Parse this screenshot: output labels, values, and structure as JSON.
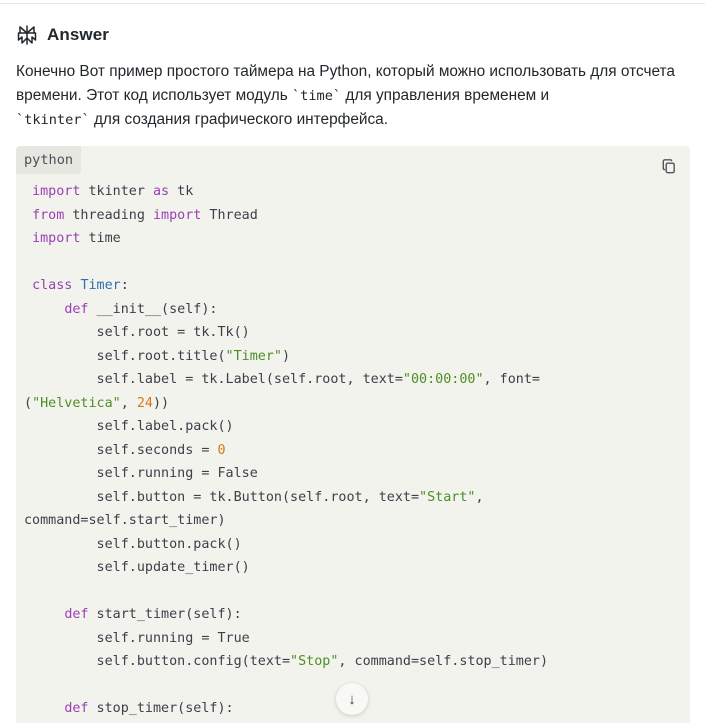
{
  "answer": {
    "title": "Answer",
    "icon": "perplexity-logo-icon"
  },
  "intro": {
    "text_1": "Конечно Вот пример простого таймера на Python, который можно использовать для отсчета времени. Этот код использует модуль ",
    "code_1": "`time`",
    "text_2": " для управления временем и ",
    "code_2": "`tkinter`",
    "text_3": " для создания графического интерфейса."
  },
  "code_block": {
    "language": "python",
    "copy_icon": "copy-icon",
    "lines": [
      [
        {
          "t": " "
        },
        {
          "t": "import",
          "c": "kw"
        },
        {
          "t": " tkinter "
        },
        {
          "t": "as",
          "c": "kw"
        },
        {
          "t": " tk"
        }
      ],
      [
        {
          "t": " "
        },
        {
          "t": "from",
          "c": "kw"
        },
        {
          "t": " threading "
        },
        {
          "t": "import",
          "c": "kw"
        },
        {
          "t": " Thread"
        }
      ],
      [
        {
          "t": " "
        },
        {
          "t": "import",
          "c": "kw"
        },
        {
          "t": " time"
        }
      ],
      [],
      [
        {
          "t": " "
        },
        {
          "t": "class",
          "c": "kw"
        },
        {
          "t": " "
        },
        {
          "t": "Timer",
          "c": "cls"
        },
        {
          "t": ":"
        }
      ],
      [
        {
          "t": "     "
        },
        {
          "t": "def",
          "c": "kw"
        },
        {
          "t": " __init__(self):"
        }
      ],
      [
        {
          "t": "         self.root = tk.Tk()"
        }
      ],
      [
        {
          "t": "         self.root.title("
        },
        {
          "t": "\"Timer\"",
          "c": "str"
        },
        {
          "t": ")"
        }
      ],
      [
        {
          "t": "         self.label = tk.Label(self.root, text="
        },
        {
          "t": "\"00:00:00\"",
          "c": "str"
        },
        {
          "t": ", font="
        }
      ],
      [
        {
          "t": "("
        },
        {
          "t": "\"Helvetica\"",
          "c": "str"
        },
        {
          "t": ", "
        },
        {
          "t": "24",
          "c": "num"
        },
        {
          "t": "))"
        }
      ],
      [
        {
          "t": "         self.label.pack()"
        }
      ],
      [
        {
          "t": "         self.seconds = "
        },
        {
          "t": "0",
          "c": "num"
        }
      ],
      [
        {
          "t": "         self.running = False"
        }
      ],
      [
        {
          "t": "         self.button = tk.Button(self.root, text="
        },
        {
          "t": "\"Start\"",
          "c": "str"
        },
        {
          "t": ","
        }
      ],
      [
        {
          "t": "command=self.start_timer)"
        }
      ],
      [
        {
          "t": "         self.button.pack()"
        }
      ],
      [
        {
          "t": "         self.update_timer()"
        }
      ],
      [],
      [
        {
          "t": "     "
        },
        {
          "t": "def",
          "c": "kw"
        },
        {
          "t": " start_timer(self):"
        }
      ],
      [
        {
          "t": "         self.running = True"
        }
      ],
      [
        {
          "t": "         self.button.config(text="
        },
        {
          "t": "\"Stop\"",
          "c": "str"
        },
        {
          "t": ", command=self.stop_timer)"
        }
      ],
      [],
      [
        {
          "t": "     "
        },
        {
          "t": "def",
          "c": "kw"
        },
        {
          "t": " stop_timer(self):"
        }
      ]
    ]
  },
  "scroll": {
    "arrow": "↓",
    "icon": "arrow-down-icon"
  }
}
